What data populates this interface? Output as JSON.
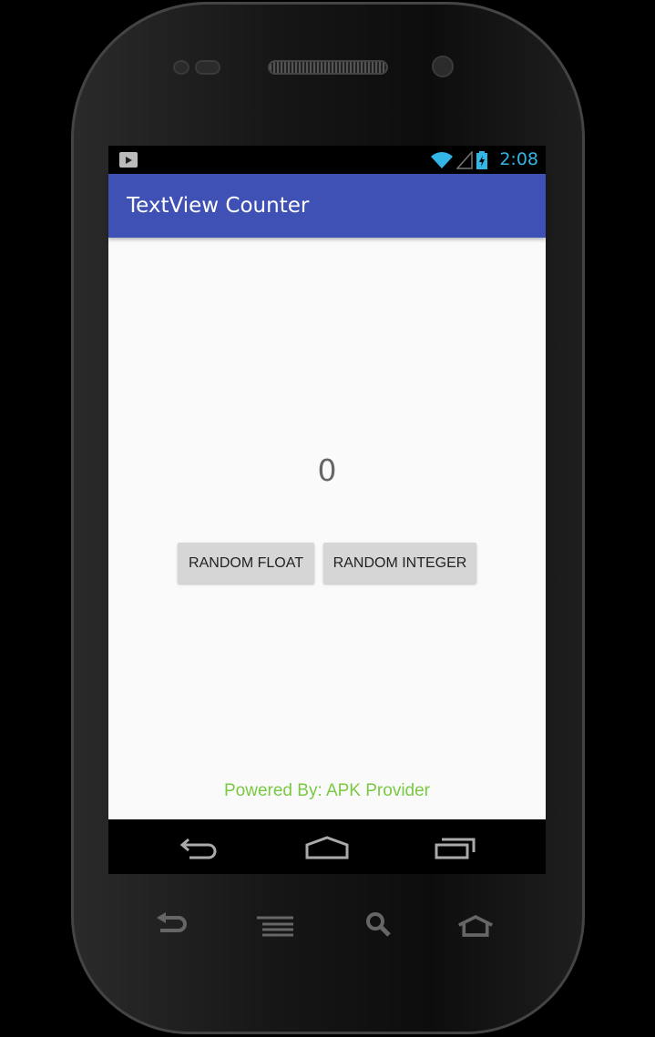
{
  "status_bar": {
    "time": "2:08",
    "icons": [
      "store-icon",
      "wifi-icon",
      "signal-icon",
      "battery-charging-icon"
    ]
  },
  "app_bar": {
    "title": "TextView Counter"
  },
  "main": {
    "counter_value": "0",
    "buttons": [
      {
        "label": "RANDOM FLOAT"
      },
      {
        "label": "RANDOM INTEGER"
      }
    ],
    "footer": "Powered By: APK Provider"
  },
  "nav_bar": {
    "icons": [
      "back-icon",
      "home-icon",
      "recents-icon"
    ]
  },
  "hardware_keys": {
    "icons": [
      "back-icon",
      "menu-icon",
      "search-icon",
      "home-icon"
    ]
  },
  "colors": {
    "primary": "#3f51b5",
    "status_accent": "#33b5e5",
    "footer_text": "#7ac943"
  }
}
